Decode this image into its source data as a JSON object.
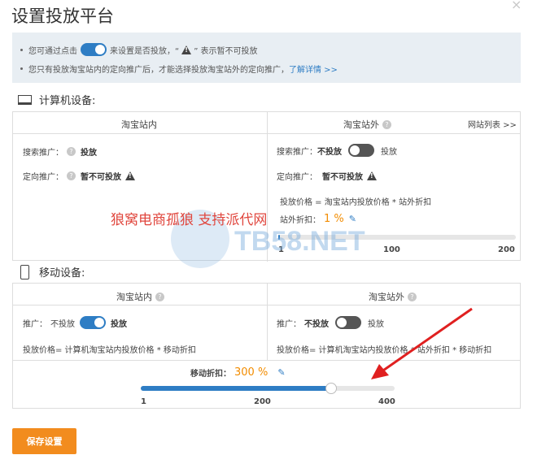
{
  "title": "设置投放平台",
  "close_icon": "×",
  "notice": {
    "line1_a": "您可通过点击",
    "line1_b": "来设置是否投放，“",
    "line1_c": "” 表示暂不可投放",
    "line2": "您只有投放淘宝站内的定向推广后，才能选择投放淘宝站外的定向推广，",
    "line2_link": "了解详情 >>"
  },
  "pc": {
    "heading": "计算机设备:",
    "inner_head": "淘宝站内",
    "outer_head": "淘宝站外",
    "site_list_link": "网站列表 >>",
    "inner": {
      "search_label": "搜索推广：",
      "search_value": "投放",
      "target_label": "定向推广：",
      "target_value": "暂不可投放"
    },
    "outer": {
      "search_label": "搜索推广：",
      "search_off": "不投放",
      "search_on": "投放",
      "target_label": "定向推广：",
      "target_value": "暂不可投放",
      "formula": "投放价格 = 淘宝站内投放价格 * 站外折扣",
      "discount_label": "站外折扣：",
      "discount_value": "1 %",
      "ticks": [
        "1",
        "100",
        "200"
      ]
    }
  },
  "mobile": {
    "heading": "移动设备:",
    "inner_head": "淘宝站内",
    "outer_head": "淘宝站外",
    "inner": {
      "promo_label": "推广：",
      "off": "不投放",
      "on": "投放",
      "formula": "投放价格= 计算机淘宝站内投放价格 * 移动折扣"
    },
    "outer": {
      "promo_label": "推广：",
      "off": "不投放",
      "on": "投放",
      "formula": "投放价格= 计算机淘宝站内投放价格 * 站外折扣 * 移动折扣"
    },
    "discount_label": "移动折扣：",
    "discount_value": "300 %",
    "slider_fraction": 0.75,
    "ticks": [
      "1",
      "200",
      "400"
    ]
  },
  "save_button": "保存设置",
  "watermark": {
    "text": "狼窝电商孤狼  支持派代网",
    "logo": "TB58.NET"
  },
  "colors": {
    "accent": "#2e7dc4",
    "orange": "#f28c1e",
    "arrow": "#e02020"
  }
}
